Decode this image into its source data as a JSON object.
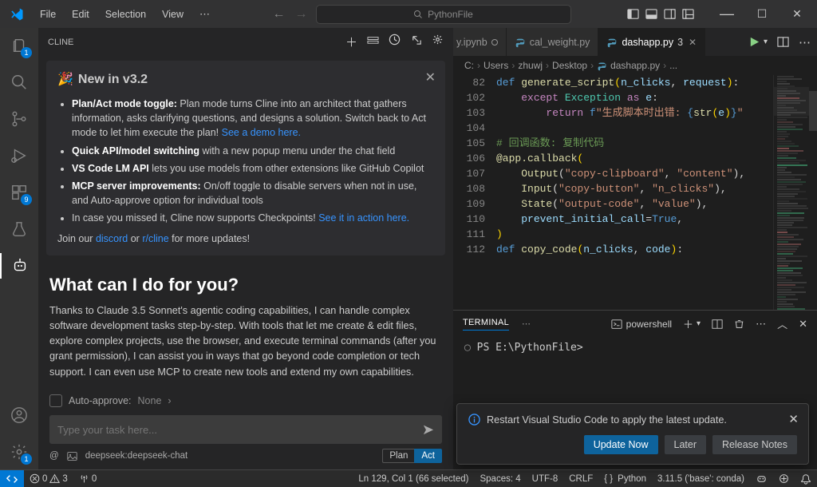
{
  "titlebar": {
    "menus": [
      "File",
      "Edit",
      "Selection",
      "View"
    ],
    "search_placeholder": "PythonFile"
  },
  "activitybar": {
    "explorer_badge": "1",
    "extensions_badge": "9",
    "settings_badge": "1"
  },
  "cline_panel": {
    "title": "CLINE",
    "card_heading": "New in v3.2",
    "bullets": [
      {
        "bold": "Plan/Act mode toggle:",
        "text": " Plan mode turns Cline into an architect that gathers information, asks clarifying questions, and designs a solution. Switch back to Act mode to let him execute the plan! ",
        "link": "See a demo here."
      },
      {
        "bold": "Quick API/model switching",
        "text": " with a new popup menu under the chat field",
        "link": ""
      },
      {
        "bold": "VS Code LM API",
        "text": " lets you use models from other extensions like GitHub Copilot",
        "link": ""
      },
      {
        "bold": "MCP server improvements:",
        "text": " On/off toggle to disable servers when not in use, and Auto-approve option for individual tools",
        "link": ""
      },
      {
        "bold": "",
        "text": "In case you missed it, Cline now supports Checkpoints! ",
        "link": "See it in action here."
      }
    ],
    "join_pre": "Join our ",
    "join_discord": "discord",
    "join_or": " or ",
    "join_rcline": "r/cline",
    "join_post": " for more updates!",
    "heading2": "What can I do for you?",
    "body_pre": "Thanks to ",
    "body_link": "Claude 3.5 Sonnet's agentic coding capabilities,",
    "body_post": " I can handle complex software development tasks step-by-step. With tools that let me create & edit files, explore complex projects, use the browser, and execute terminal commands (after you grant permission), I can assist you in ways that go beyond code completion or tech support. I can even use MCP to create new tools and extend my own capabilities.",
    "auto_approve_label": "Auto-approve:",
    "auto_approve_value": "None",
    "input_placeholder": "Type your task here...",
    "model_label": "deepseek:deepseek-chat",
    "mode_plan": "Plan",
    "mode_act": "Act"
  },
  "editor": {
    "tabs": [
      {
        "name": "y.ipynb",
        "color": "#d07734"
      },
      {
        "name": "cal_weight.py",
        "color": "#519aba"
      },
      {
        "name": "dashapp.py",
        "badge": "3",
        "color": "#519aba"
      }
    ],
    "breadcrumbs": [
      "C:",
      "Users",
      "zhuwj",
      "Desktop",
      "dashapp.py",
      "..."
    ],
    "line_numbers": [
      "82",
      "102",
      "103",
      "104",
      "105",
      "106",
      "107",
      "108",
      "109",
      "110",
      "111",
      "112"
    ],
    "code_lines": {
      "l82": {
        "indent": "",
        "kw1": "def ",
        "fn": "generate_script",
        "paren1": "(",
        "arg1": "n_clicks",
        "comma1": ", ",
        "arg2": "request",
        "paren2": ")",
        "colon": ":"
      },
      "l102": {
        "indent": "    ",
        "kw1": "except ",
        "cls": "Exception",
        "kw2": " as ",
        "var": "e",
        "colon": ":"
      },
      "l103": {
        "indent": "        ",
        "kw1": "return ",
        "fpre": "f",
        "str1": "\"生成脚本时出错: ",
        "brace1": "{",
        "fn": "str",
        "paren1": "(",
        "var": "e",
        "paren2": ")",
        "brace2": "}",
        "str2": "\""
      },
      "l104": "",
      "l105": {
        "text": "# 回调函数: 复制代码"
      },
      "l106": {
        "decor": "@app.callback",
        "paren": "("
      },
      "l107": {
        "indent": "    ",
        "fn": "Output",
        "paren1": "(",
        "str1": "\"copy-clipboard\"",
        "comma": ", ",
        "str2": "\"content\"",
        "paren2": ")",
        "tail": ","
      },
      "l108": {
        "indent": "    ",
        "fn": "Input",
        "paren1": "(",
        "str1": "\"copy-button\"",
        "comma": ", ",
        "str2": "\"n_clicks\"",
        "paren2": ")",
        "tail": ","
      },
      "l109": {
        "indent": "    ",
        "fn": "State",
        "paren1": "(",
        "str1": "\"output-code\"",
        "comma": ", ",
        "str2": "\"value\"",
        "paren2": ")",
        "tail": ","
      },
      "l110": {
        "indent": "    ",
        "arg": "prevent_initial_call",
        "eq": "=",
        "val": "True",
        "tail": ","
      },
      "l111": {
        "paren": ")"
      },
      "l112": {
        "kw1": "def ",
        "fn": "copy_code",
        "paren1": "(",
        "arg1": "n_clicks",
        "comma": ", ",
        "arg2": "code",
        "paren2": ")",
        "colon": ":"
      }
    }
  },
  "terminal": {
    "tab_label": "TERMINAL",
    "shell": "powershell",
    "prompt": "PS E:\\PythonFile>"
  },
  "notification": {
    "message": "Restart Visual Studio Code to apply the latest update.",
    "btn_update": "Update Now",
    "btn_later": "Later",
    "btn_notes": "Release Notes"
  },
  "statusbar": {
    "errors": "0",
    "warnings": "3",
    "ports": "0",
    "ln_col": "Ln 129, Col 1 (66 selected)",
    "spaces": "Spaces: 4",
    "encoding": "UTF-8",
    "eol": "CRLF",
    "lang": "Python",
    "interpreter": "3.11.5 ('base': conda)"
  }
}
